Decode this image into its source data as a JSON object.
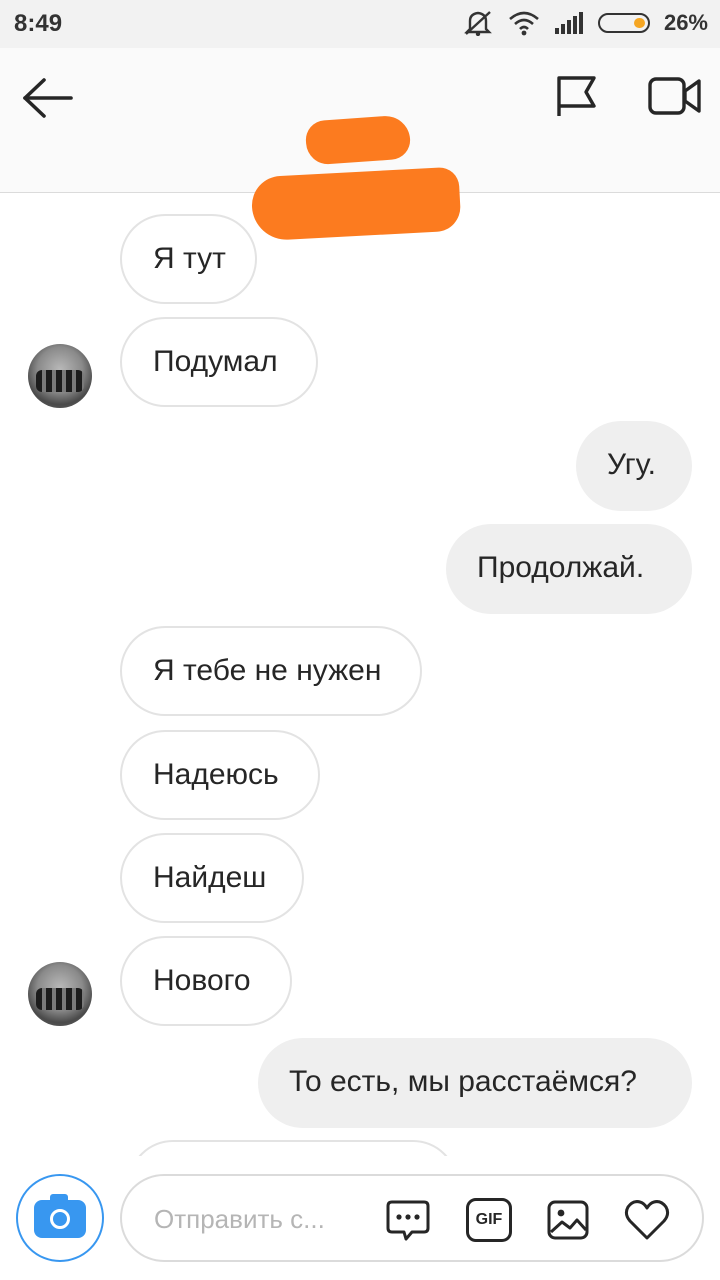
{
  "status_bar": {
    "time": "8:49",
    "battery_percent_label": "26%",
    "battery_level": 0.26,
    "icons": [
      "mute-icon",
      "wifi-icon",
      "signal-icon",
      "battery-icon"
    ]
  },
  "header": {
    "icons": [
      "back-arrow-icon",
      "flag-icon",
      "video-call-icon"
    ],
    "title_redacted": true
  },
  "messages": [
    {
      "direction": "incoming",
      "text": "Я тут",
      "avatar": false
    },
    {
      "direction": "incoming",
      "text": "Подумал",
      "avatar": true
    },
    {
      "direction": "outgoing",
      "text": "Угу."
    },
    {
      "direction": "outgoing",
      "text": "Продолжай."
    },
    {
      "direction": "incoming",
      "text": "Я тебе не нужен",
      "avatar": false
    },
    {
      "direction": "incoming",
      "text": "Надеюсь",
      "avatar": false
    },
    {
      "direction": "incoming",
      "text": "Найдеш",
      "avatar": false
    },
    {
      "direction": "incoming",
      "text": "Нового",
      "avatar": true
    },
    {
      "direction": "outgoing",
      "text": "То есть, мы расстаёмся?"
    }
  ],
  "composer": {
    "placeholder": "Отправить с...",
    "gif_label": "GIF",
    "icons": [
      "camera-icon",
      "sticker-chat-icon",
      "gif-icon",
      "gallery-icon",
      "heart-icon"
    ]
  },
  "colors": {
    "accent": "#3897f0",
    "incoming_bubble_border": "#e3e3e3",
    "outgoing_bubble_bg": "#efefef",
    "redaction": "#fc7b1f"
  }
}
